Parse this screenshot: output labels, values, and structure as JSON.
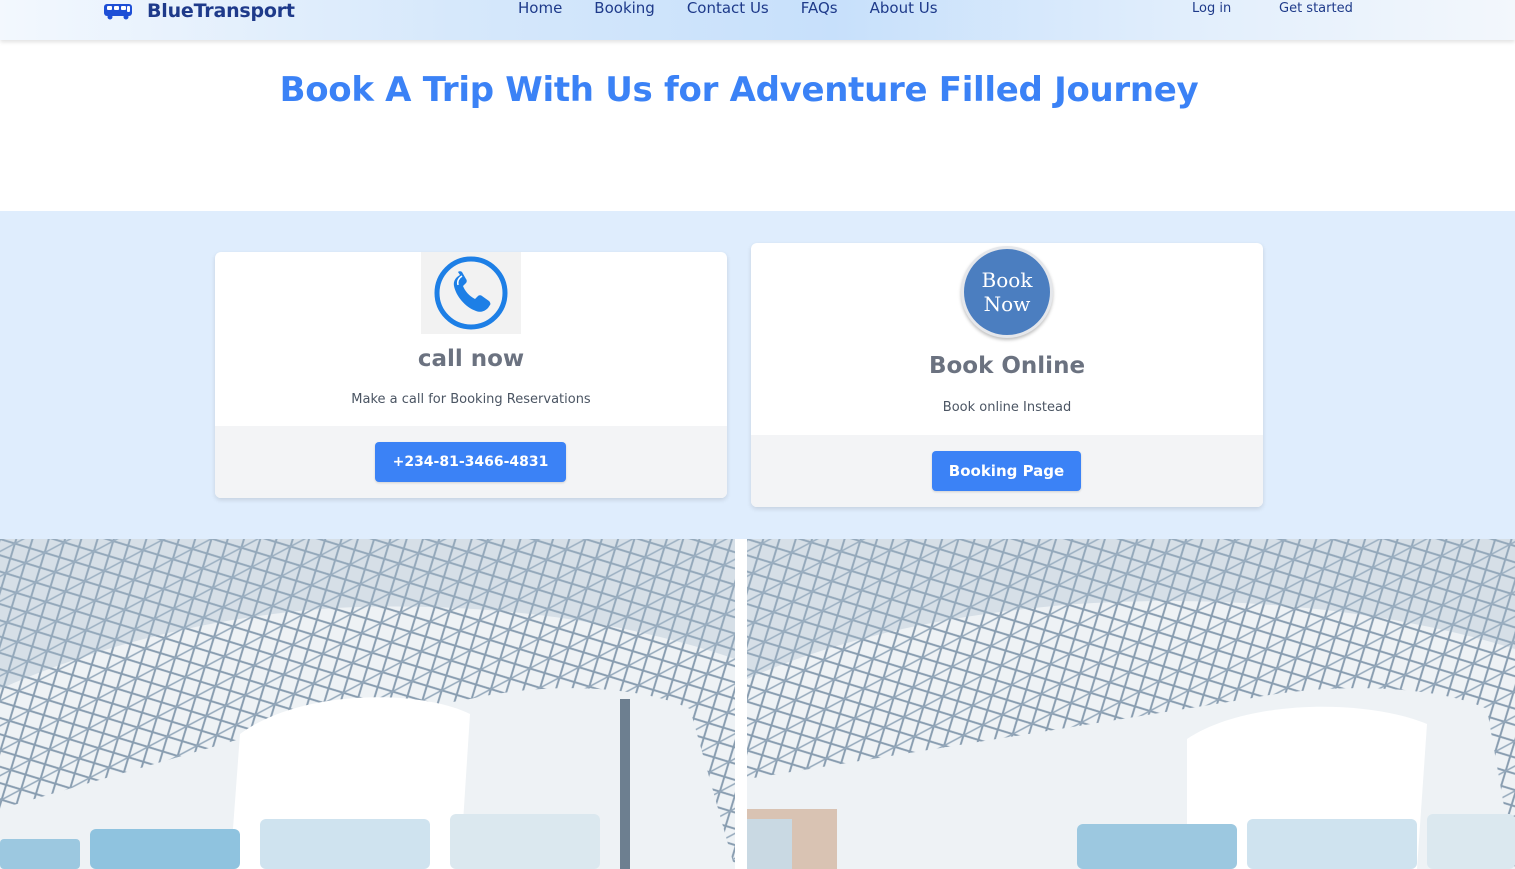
{
  "header": {
    "brand_name": "BlueTransport",
    "brand_icon": "bus-icon",
    "nav": [
      "Home",
      "Booking",
      "Contact Us",
      "FAQs",
      "About Us"
    ],
    "login_label": "Log in",
    "get_started_label": "Get started"
  },
  "hero": {
    "title": "Book A Trip With Us for Adventure Filled Journey"
  },
  "cards": {
    "call": {
      "icon": "phone-icon",
      "title": "call now",
      "subtitle": "Make a call for Booking Reservations",
      "button_label": "+234-81-3466-4831"
    },
    "book": {
      "badge_line1": "Book",
      "badge_line2": "Now",
      "title": "Book Online",
      "subtitle": "Book online Instead",
      "button_label": "Booking Page"
    }
  },
  "colors": {
    "accent": "#3b82f6",
    "brand_dark": "#1e3a8a",
    "band_bg": "#dfedfd",
    "badge_blue": "#4b7ec0"
  }
}
